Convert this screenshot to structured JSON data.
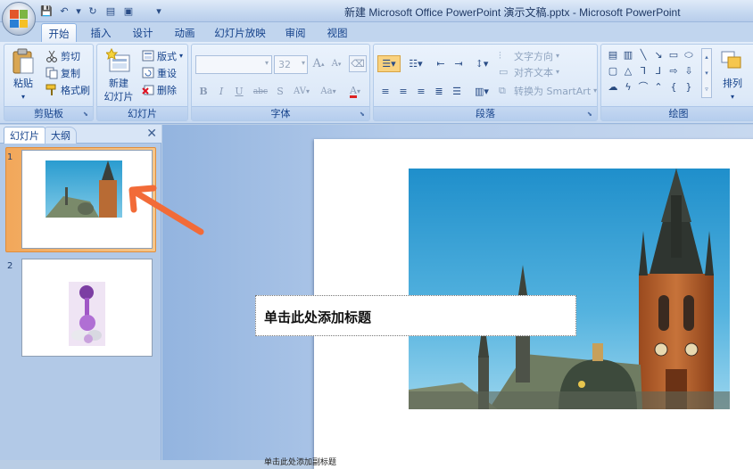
{
  "window": {
    "title": "新建 Microsoft Office PowerPoint 演示文稿.pptx - Microsoft PowerPoint"
  },
  "quick_access": [
    {
      "name": "save-icon",
      "glyph": "💾"
    },
    {
      "name": "undo-icon",
      "glyph": "↶"
    },
    {
      "name": "undo-dropdown-icon",
      "glyph": "▾"
    },
    {
      "name": "redo-icon",
      "glyph": "↻"
    },
    {
      "name": "layout-icon",
      "glyph": "▤"
    },
    {
      "name": "new-slide-qat-icon",
      "glyph": "▣"
    },
    {
      "name": "customize-qat-icon",
      "glyph": "▾"
    }
  ],
  "tabs": [
    {
      "label": "开始",
      "active": true
    },
    {
      "label": "插入"
    },
    {
      "label": "设计"
    },
    {
      "label": "动画"
    },
    {
      "label": "幻灯片放映"
    },
    {
      "label": "审阅"
    },
    {
      "label": "视图"
    }
  ],
  "ribbon": {
    "clipboard": {
      "label": "剪贴板",
      "paste": "粘贴",
      "cut": "剪切",
      "copy": "复制",
      "format_painter": "格式刷"
    },
    "slides": {
      "label": "幻灯片",
      "new_slide_line1": "新建",
      "new_slide_line2": "幻灯片",
      "layout": "版式",
      "reset": "重设",
      "delete": "删除"
    },
    "font": {
      "label": "字体",
      "font_size": "32",
      "bold": "B",
      "italic": "I",
      "underline": "U",
      "strike": "abc",
      "shadow": "S",
      "spacing": "AV",
      "case": "Aa",
      "color": "A",
      "grow": "A",
      "shrink": "A"
    },
    "paragraph": {
      "label": "段落",
      "text_direction": "文字方向",
      "align_text": "对齐文本",
      "convert_smartart": "转换为 SmartArt"
    },
    "drawing": {
      "label": "绘图",
      "arrange": "排列"
    }
  },
  "left_panel": {
    "tabs": [
      {
        "label": "幻灯片",
        "active": true
      },
      {
        "label": "大纲"
      }
    ],
    "close": "✕",
    "slides": [
      {
        "number": "1",
        "image": "church-tower",
        "selected": true
      },
      {
        "number": "2",
        "image": "vase-flowers"
      }
    ]
  },
  "slide": {
    "title_placeholder": "单击此处添加标题",
    "subtitle_placeholder": "单击此处添加副标题"
  },
  "colors": {
    "accent": "#f26b38",
    "ribbon": "#dbe7f7",
    "selection": "#f5b06a"
  }
}
